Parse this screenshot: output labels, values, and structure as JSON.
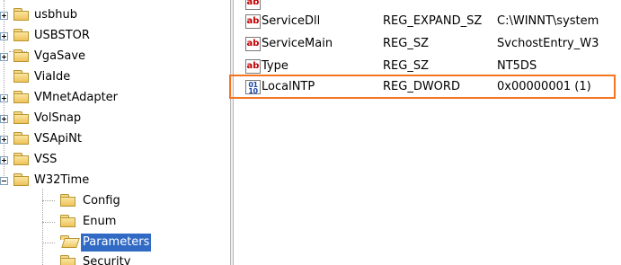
{
  "tree": {
    "items": [
      {
        "label": "usbhub",
        "expander": "plus",
        "selected": false
      },
      {
        "label": "USBSTOR",
        "expander": "plus",
        "selected": false
      },
      {
        "label": "VgaSave",
        "expander": "plus",
        "selected": false
      },
      {
        "label": "ViaIde",
        "expander": "none",
        "selected": false
      },
      {
        "label": "VMnetAdapter",
        "expander": "plus",
        "selected": false
      },
      {
        "label": "VolSnap",
        "expander": "plus",
        "selected": false
      },
      {
        "label": "VSApiNt",
        "expander": "plus",
        "selected": false
      },
      {
        "label": "VSS",
        "expander": "plus",
        "selected": false
      },
      {
        "label": "W32Time",
        "expander": "minus",
        "selected": false
      },
      {
        "label": "Config",
        "expander": "none",
        "selected": false
      },
      {
        "label": "Enum",
        "expander": "none",
        "selected": false
      },
      {
        "label": "Parameters",
        "expander": "none",
        "selected": true
      },
      {
        "label": "Security",
        "expander": "none",
        "selected": false
      }
    ]
  },
  "values": {
    "rows": [
      {
        "name": "ServiceDll",
        "type": "REG_EXPAND_SZ",
        "data": "C:\\WINNT\\system",
        "icon": "string-value-icon",
        "icon_text": "ab"
      },
      {
        "name": "ServiceMain",
        "type": "REG_SZ",
        "data": "SvchostEntry_W3",
        "icon": "string-value-icon",
        "icon_text": "ab"
      },
      {
        "name": "Type",
        "type": "REG_SZ",
        "data": "NT5DS",
        "icon": "string-value-icon",
        "icon_text": "ab"
      },
      {
        "name": "LocalNTP",
        "type": "REG_DWORD",
        "data": "0x00000001 (1)",
        "icon": "dword-value-icon",
        "icon_text": "01\n10",
        "highlighted": true
      }
    ]
  },
  "colors": {
    "selection": "#316ac5",
    "highlight_border": "#f47421",
    "string_icon": "#c00000",
    "binary_icon": "#1848a8"
  }
}
